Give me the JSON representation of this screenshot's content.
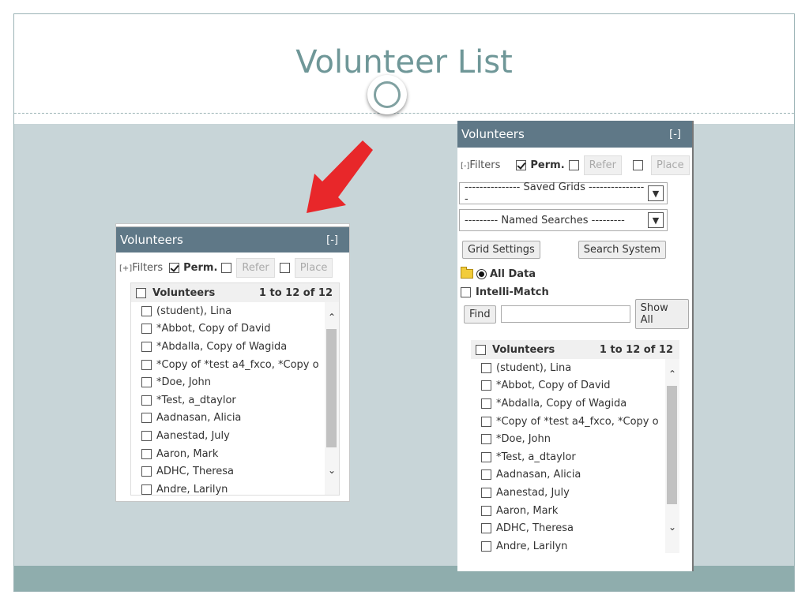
{
  "slide": {
    "title": "Volunteer List"
  },
  "colors": {
    "header_bg": "#5f7887",
    "content_bg": "#c8d5d8",
    "title_color": "#6f9798",
    "arrow": "#e8272a"
  },
  "small_panel": {
    "header_title": "Volunteers",
    "collapse_toggle": "[-]",
    "filters_prefix": "[+]",
    "filters_label": "Filters",
    "perm_label": "Perm.",
    "refer_label": "Refer",
    "place_label": "Place",
    "grid_title": "Volunteers",
    "grid_count": "1 to 12 of 12",
    "rows": [
      "(student), Lina",
      "*Abbot, Copy of David",
      "*Abdalla, Copy of Wagida",
      "*Copy of *test a4_fxco, *Copy o",
      "*Doe, John",
      "*Test, a_dtaylor",
      "Aadnasan, Alicia",
      "Aanestad, July",
      "Aaron, Mark",
      "ADHC, Theresa",
      "Andre, Larilyn"
    ]
  },
  "large_panel": {
    "header_title": "Volunteers",
    "collapse_toggle": "[-]",
    "filters_prefix": "[-]",
    "filters_label": "Filters",
    "perm_label": "Perm.",
    "refer_label": "Refer",
    "place_label": "Place",
    "saved_grids": "--------------- Saved Grids ----------------",
    "named_searches": "--------- Named Searches ---------",
    "grid_settings": "Grid Settings",
    "search_system": "Search System",
    "all_data": "All Data",
    "intelli_match": "Intelli-Match",
    "find": "Find",
    "find_value": "",
    "show_all": "Show All",
    "grid_title": "Volunteers",
    "grid_count": "1 to 12 of 12",
    "rows": [
      "(student), Lina",
      "*Abbot, Copy of David",
      "*Abdalla, Copy of Wagida",
      "*Copy of *test a4_fxco, *Copy o",
      "*Doe, John",
      "*Test, a_dtaylor",
      "Aadnasan, Alicia",
      "Aanestad, July",
      "Aaron, Mark",
      "ADHC, Theresa",
      "Andre, Larilyn"
    ]
  }
}
